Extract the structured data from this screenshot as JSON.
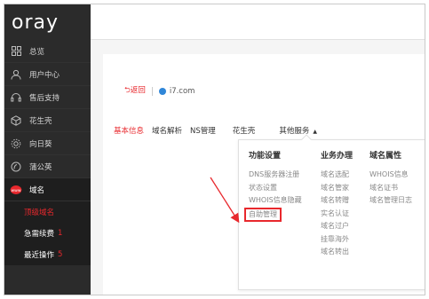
{
  "logo": "oray",
  "sidebar": {
    "items": [
      {
        "label": "总览",
        "icon": "grid-icon"
      },
      {
        "label": "用户中心",
        "icon": "user-icon"
      },
      {
        "label": "售后支持",
        "icon": "headset-icon"
      },
      {
        "label": "花生壳",
        "icon": "cube-icon"
      },
      {
        "label": "向日葵",
        "icon": "sunflower-icon"
      },
      {
        "label": "蒲公英",
        "icon": "dandelion-icon"
      },
      {
        "label": "域名",
        "icon": "domain-icon"
      }
    ],
    "subitems": [
      {
        "label": "顶级域名",
        "count": ""
      },
      {
        "label": "急需续费",
        "count": "1"
      },
      {
        "label": "最近操作",
        "count": "5"
      }
    ]
  },
  "header": {
    "back_label": "返回",
    "domain": "i7.com"
  },
  "tabs": [
    "基本信息",
    "域名解析",
    "NS管理",
    "花生壳",
    "其他服务"
  ],
  "dropdown": {
    "columns": [
      {
        "title": "功能设置",
        "items": [
          "DNS服务器注册",
          "状态设置",
          "WHOIS信息隐藏",
          "自助管理"
        ]
      },
      {
        "title": "业务办理",
        "items": [
          "域名选配",
          "域名管家",
          "域名转赠",
          "实名认证",
          "域名过户",
          "挂靠海外",
          "域名转出"
        ]
      },
      {
        "title": "域名属性",
        "items": [
          "WHOIS信息",
          "域名证书",
          "域名管理日志"
        ]
      }
    ]
  },
  "colors": {
    "accent": "#e8282d",
    "sidebar": "#2b2b2b"
  }
}
